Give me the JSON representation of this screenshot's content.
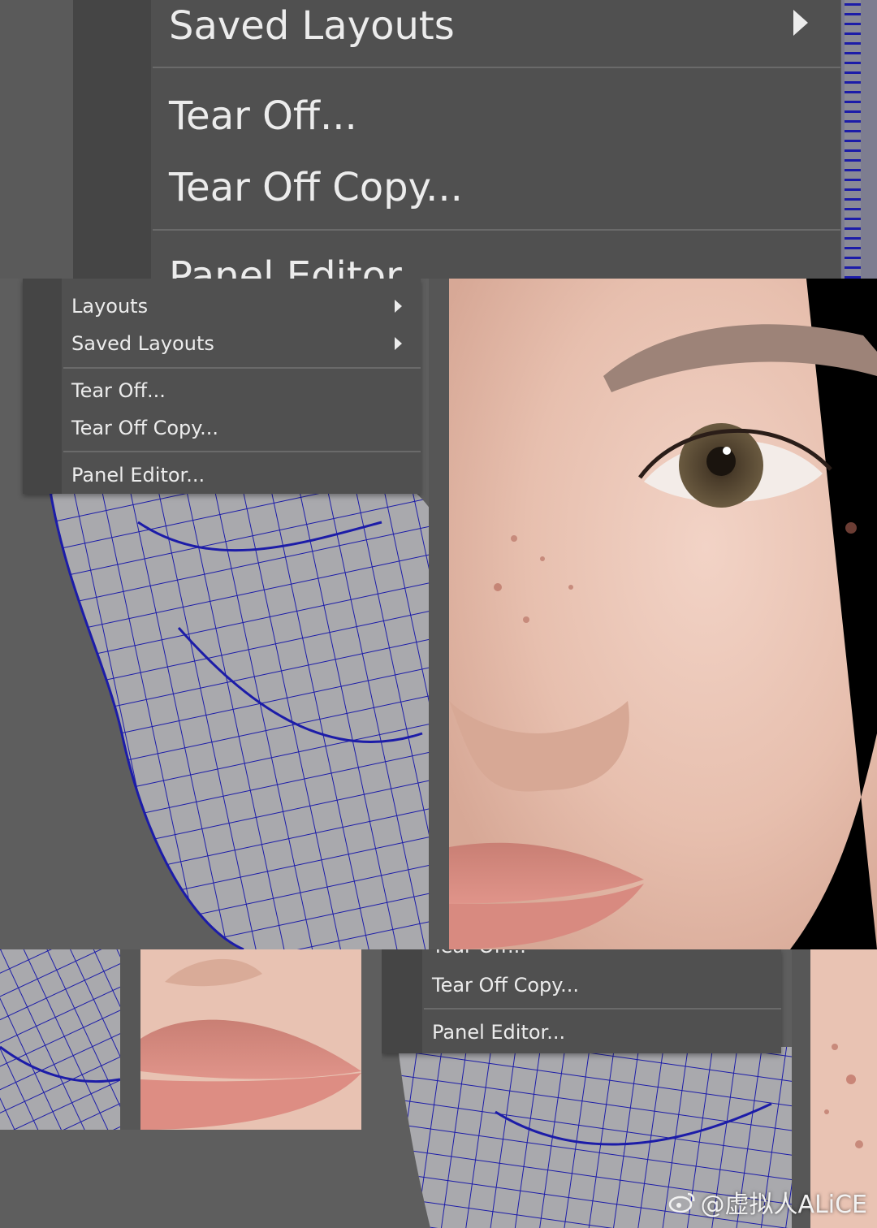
{
  "big_menu": {
    "saved_layouts": "Saved Layouts",
    "tear_off": "Tear Off...",
    "tear_off_copy": "Tear Off Copy...",
    "panel_editor": "Panel Editor"
  },
  "mid_menu": {
    "layouts": "Layouts",
    "saved_layouts": "Saved Layouts",
    "tear_off": "Tear Off...",
    "tear_off_copy": "Tear Off Copy...",
    "panel_editor": "Panel Editor..."
  },
  "low_menu": {
    "tear_off": "Tear Off...",
    "tear_off_copy": "Tear Off Copy...",
    "panel_editor": "Panel Editor..."
  },
  "watermark": {
    "text": "@虚拟人ALiCE"
  },
  "colors": {
    "wire": "#1c1ca8",
    "mesh_base": "#a9a9ad",
    "menu_bg": "#505050",
    "skin": "#e9c6b6"
  }
}
